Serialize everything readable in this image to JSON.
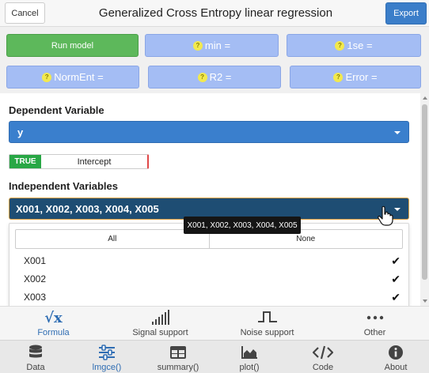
{
  "header": {
    "cancel": "Cancel",
    "title": "Generalized Cross Entropy linear regression",
    "export": "Export"
  },
  "results": {
    "run": "Run model",
    "min": "min =",
    "one_se": "1se =",
    "normEnt": "NormEnt =",
    "r2": "R2 =",
    "error": "Error ="
  },
  "form": {
    "dep_label": "Dependent Variable",
    "dep_value": "y",
    "intercept_state": "TRUE",
    "intercept_label": "Intercept",
    "ind_label": "Independent Variables",
    "ind_value": "X001, X002, X003, X004, X005",
    "tooltip": "X001, X002, X003, X004, X005",
    "select_all": "All",
    "select_none": "None",
    "options": [
      {
        "label": "X001",
        "checked": true
      },
      {
        "label": "X002",
        "checked": true
      },
      {
        "label": "X003",
        "checked": true
      }
    ]
  },
  "subtabs": [
    {
      "label": "Formula",
      "icon": "formula-icon",
      "active": true
    },
    {
      "label": "Signal support",
      "icon": "signal-bars-icon",
      "active": false
    },
    {
      "label": "Noise support",
      "icon": "pulse-wave-icon",
      "active": false
    },
    {
      "label": "Other",
      "icon": "ellipsis-icon",
      "active": false
    }
  ],
  "navtabs": [
    {
      "label": "Data",
      "icon": "database-icon",
      "active": false
    },
    {
      "label": "lmgce()",
      "icon": "sliders-icon",
      "active": true
    },
    {
      "label": "summary()",
      "icon": "table-icon",
      "active": false
    },
    {
      "label": "plot()",
      "icon": "area-chart-icon",
      "active": false
    },
    {
      "label": "Code",
      "icon": "code-icon",
      "active": false
    },
    {
      "label": "About",
      "icon": "info-icon",
      "active": false
    }
  ],
  "colors": {
    "accent": "#3b7ec9",
    "run": "#5db85b",
    "stat": "#a4bdf4",
    "selected_dark": "#1e4d73",
    "true_badge": "#28a745"
  }
}
